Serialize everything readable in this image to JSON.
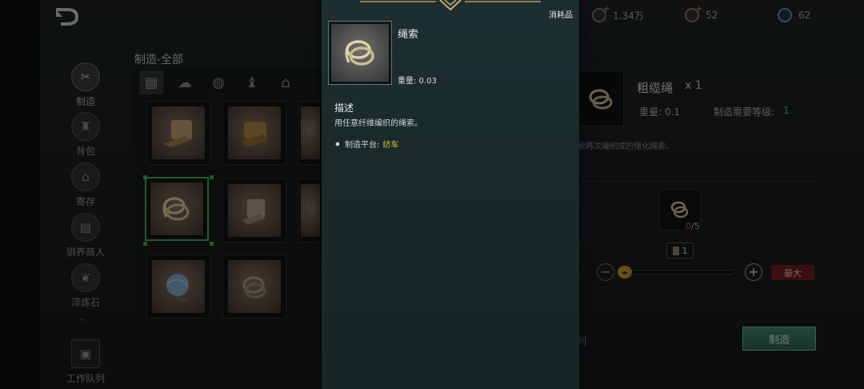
{
  "currencies": [
    {
      "name": "silver-coin",
      "value": "1.34万",
      "has_plus": true
    },
    {
      "name": "red-coin",
      "value": "52",
      "has_plus": true
    },
    {
      "name": "blue-coin",
      "value": "62",
      "has_plus": false
    }
  ],
  "nav": {
    "items": [
      {
        "label": "制造",
        "icon": "hammer-icon",
        "active": true
      },
      {
        "label": "背包",
        "icon": "bag-icon",
        "active": false
      },
      {
        "label": "寄存",
        "icon": "house-icon",
        "active": false
      },
      {
        "label": "驯养商人",
        "icon": "cart-icon",
        "active": false
      },
      {
        "label": "淬炼石",
        "icon": "leaf-icon",
        "active": false
      }
    ],
    "work_queue_label": "工作队列"
  },
  "craft": {
    "title": "制造-全部",
    "tabs": [
      "grid-all-icon",
      "ore-icon",
      "yarn-icon",
      "potion-icon",
      "building-icon"
    ],
    "grid_items": [
      {
        "item": "cloth-roll"
      },
      {
        "item": "leather-roll"
      },
      {
        "item": "partial-item"
      },
      {
        "item": "rope",
        "selected": true
      },
      {
        "item": "fabric-roll"
      },
      {
        "item": "partial-item-2"
      },
      {
        "item": "blue-yarn-ball"
      },
      {
        "item": "thick-rope"
      }
    ]
  },
  "detail": {
    "name": "粗缆绳",
    "qty": "x 1",
    "weight": "重量: 0.1",
    "level_label": "制造需要等级:",
    "level_value": "1",
    "description_fragment": "索再次编织成的强化绳索。",
    "material_have": "0",
    "material_need": "/5",
    "quantity": "1",
    "max_label": "最大",
    "queue_label": "查看队列",
    "craft_label": "制造",
    "slider_fraction": 0.0
  },
  "tooltip": {
    "category": "消耗品",
    "name": "绳索",
    "weight": "重量: 0.03",
    "desc_title": "描述",
    "desc": "用任意纤维编织的绳索。",
    "platform_label": "制造平台:",
    "platform_value": "纺车"
  }
}
